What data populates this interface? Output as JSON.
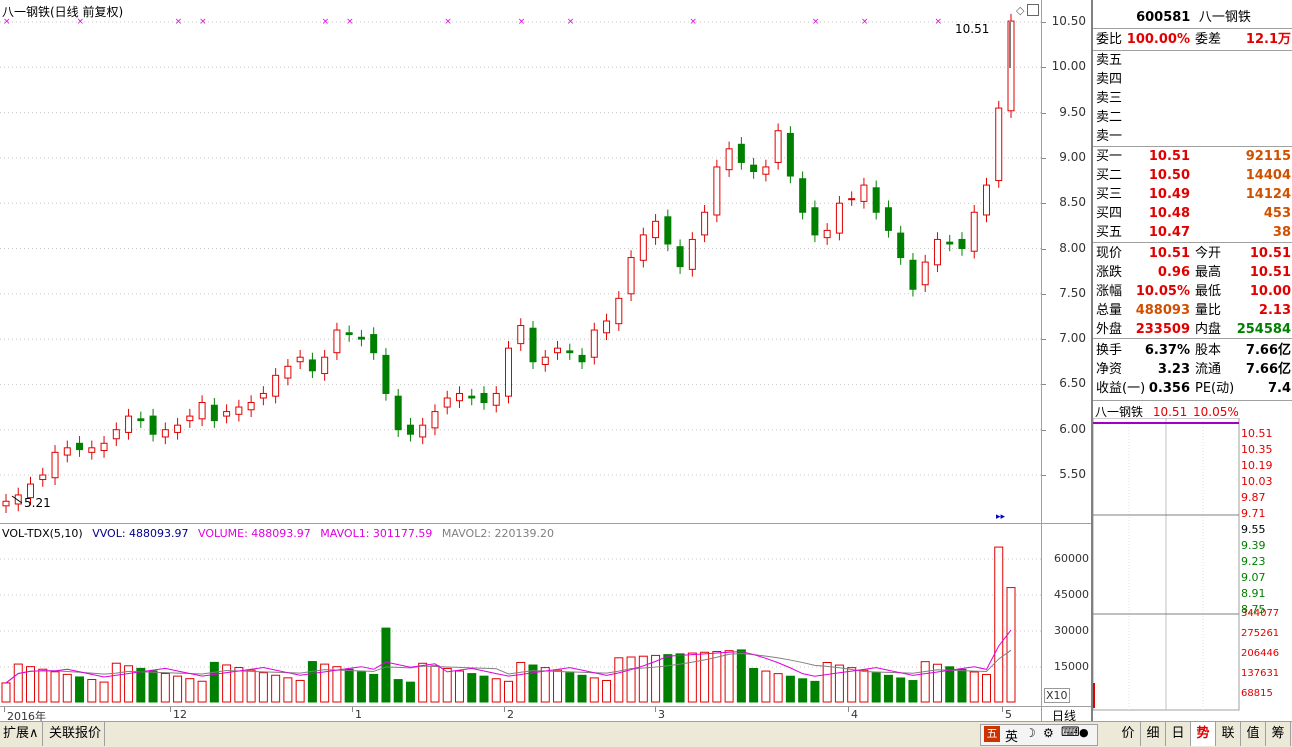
{
  "chart_title": "八一钢铁(日线 前复权)",
  "price_panel": {
    "low_annotation": "5.21",
    "high_annotation": "10.51",
    "y_ticks": [
      "10.50",
      "10.00",
      "9.50",
      "9.00",
      "8.50",
      "8.00",
      "7.50",
      "7.00",
      "6.50",
      "6.00",
      "5.50"
    ]
  },
  "vol_panel": {
    "legend": {
      "name": "VOL-TDX(5,10)",
      "vvol": "VVOL: 488093.97",
      "volume": "VOLUME: 488093.97",
      "mavol1": "MAVOL1: 301177.59",
      "mavol2": "MAVOL2: 220139.20"
    },
    "y_ticks": [
      "60000",
      "45000",
      "30000",
      "15000"
    ],
    "unit": "X10"
  },
  "x_axis": {
    "labels": [
      "2016年",
      "12",
      "1",
      "2",
      "3",
      "4",
      "5"
    ]
  },
  "period_label": "日线",
  "bottom_tabs": [
    "扩展∧",
    "关联报价"
  ],
  "ime_items": [
    "英",
    "☽",
    "⚙",
    "⌨",
    "👤",
    "⚙"
  ],
  "quote": {
    "code": "600581",
    "name": "八一钢铁",
    "weibi_label": "委比",
    "weibi": "100.00%",
    "weicha_label": "委差",
    "weicha": "12.1万",
    "sell": [
      {
        "label": "卖五",
        "price": "",
        "vol": ""
      },
      {
        "label": "卖四",
        "price": "",
        "vol": ""
      },
      {
        "label": "卖三",
        "price": "",
        "vol": ""
      },
      {
        "label": "卖二",
        "price": "",
        "vol": ""
      },
      {
        "label": "卖一",
        "price": "",
        "vol": ""
      }
    ],
    "buy": [
      {
        "label": "买一",
        "price": "10.51",
        "vol": "92115"
      },
      {
        "label": "买二",
        "price": "10.50",
        "vol": "14404"
      },
      {
        "label": "买三",
        "price": "10.49",
        "vol": "14124"
      },
      {
        "label": "买四",
        "price": "10.48",
        "vol": "453"
      },
      {
        "label": "买五",
        "price": "10.47",
        "vol": "38"
      }
    ],
    "stats": [
      {
        "l1": "现价",
        "v1": "10.51",
        "c1": "red",
        "l2": "今开",
        "v2": "10.51",
        "c2": "red"
      },
      {
        "l1": "涨跌",
        "v1": "0.96",
        "c1": "red",
        "l2": "最高",
        "v2": "10.51",
        "c2": "red"
      },
      {
        "l1": "涨幅",
        "v1": "10.05%",
        "c1": "red",
        "l2": "最低",
        "v2": "10.00",
        "c2": "red"
      },
      {
        "l1": "总量",
        "v1": "488093",
        "c1": "orange",
        "l2": "量比",
        "v2": "2.13",
        "c2": "red"
      },
      {
        "l1": "外盘",
        "v1": "233509",
        "c1": "red",
        "l2": "内盘",
        "v2": "254584",
        "c2": "green"
      }
    ],
    "fund": [
      {
        "l1": "换手",
        "v1": "6.37%",
        "l2": "股本",
        "v2": "7.66亿"
      },
      {
        "l1": "净资",
        "v1": "3.23",
        "l2": "流通",
        "v2": "7.66亿"
      },
      {
        "l1": "收益(一)",
        "v1": "0.356",
        "l2": "PE(动)",
        "v2": "7.4"
      }
    ],
    "mini_title": "八一钢铁",
    "mini_price": "10.51",
    "mini_pct": "10.05%",
    "mini_price_ticks": [
      "10.51",
      "10.35",
      "10.19",
      "10.03",
      "9.87",
      "9.71",
      "9.55",
      "9.39",
      "9.23",
      "9.07",
      "8.91",
      "8.75"
    ],
    "mini_vol_ticks": [
      "344077",
      "275261",
      "206446",
      "137631",
      "68815"
    ]
  },
  "right_tabs": [
    "价",
    "细",
    "日",
    "势",
    "联",
    "值",
    "筹"
  ],
  "right_tab_active": "势",
  "colors": {
    "up": "#e00000",
    "down": "#008000",
    "ma1": "#e000e0",
    "ma2": "#808080",
    "grid": "#c0c0c0"
  }
}
